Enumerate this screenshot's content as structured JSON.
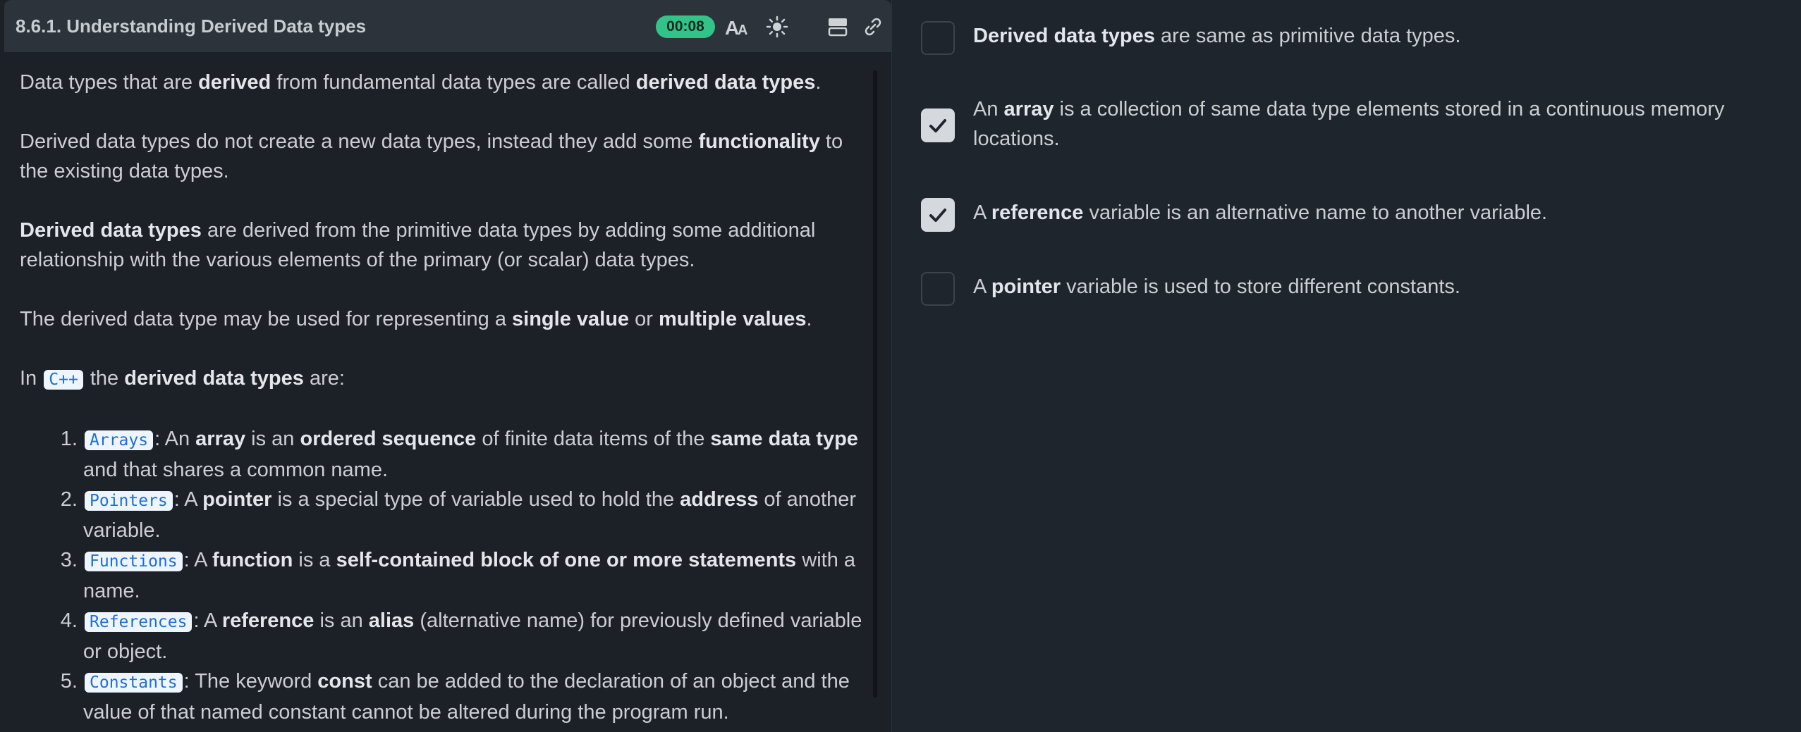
{
  "header": {
    "title": "8.6.1. Understanding Derived Data types",
    "timer": "00:08",
    "icons": [
      "font-size-icon",
      "theme-toggle-icon",
      "layout-icon",
      "link-icon"
    ]
  },
  "content": {
    "p1": {
      "a": "Data types that are ",
      "b": "derived",
      "c": " from fundamental data types are called ",
      "d": "derived data types",
      "e": "."
    },
    "p2": {
      "a": "Derived data types do not create a new data types, instead they add some ",
      "b": "functionality",
      "c": " to the existing data types."
    },
    "p3": {
      "a": "Derived data types",
      "b": " are derived from the primitive data types by adding some additional relationship with the various elements of the primary (or scalar) data types."
    },
    "p4": {
      "a": "The derived data type may be used for representing a ",
      "b": "single value",
      "c": " or ",
      "d": "multiple values",
      "e": "."
    },
    "p5": {
      "a": "In ",
      "code": "C++",
      "b": " the ",
      "c": "derived data types",
      "d": " are:"
    },
    "list": [
      {
        "code": "Arrays",
        "a": ": An ",
        "b": "array",
        "c": " is an ",
        "d": "ordered sequence",
        "e": " of finite data items of the ",
        "f": "same data type",
        "g": " and that shares a common name."
      },
      {
        "code": "Pointers",
        "a": ": A ",
        "b": "pointer",
        "c": " is a special type of variable used to hold the ",
        "d": "address",
        "e": " of another variable."
      },
      {
        "code": "Functions",
        "a": ": A ",
        "b": "function",
        "c": " is a ",
        "d": "self-contained block of one or more statements",
        "e": " with a name."
      },
      {
        "code": "References",
        "a": ": A ",
        "b": "reference",
        "c": " is an ",
        "d": "alias",
        "e": " (alternative name) for previously defined variable or object."
      },
      {
        "code": "Constants",
        "a": ": The keyword ",
        "b": "const",
        "c": " can be added to the declaration of an object and the value of that named constant cannot be altered during the program run."
      }
    ]
  },
  "options": [
    {
      "checked": false,
      "b": "Derived data types",
      "a": "",
      "c": " are same as primitive data types."
    },
    {
      "checked": true,
      "a": "An ",
      "b": "array",
      "c": " is a collection of same data type elements stored in a continuous memory locations."
    },
    {
      "checked": true,
      "a": "A ",
      "b": "reference",
      "c": " variable is an alternative name to another variable."
    },
    {
      "checked": false,
      "a": "A ",
      "b": "pointer",
      "c": " variable is used to store different constants."
    }
  ],
  "colors": {
    "accent": "#33c389",
    "code_text": "#1f6fd1",
    "code_bg": "#eef5ff"
  }
}
